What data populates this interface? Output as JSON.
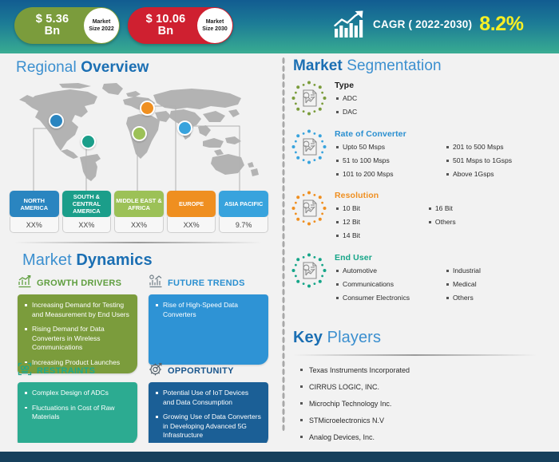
{
  "header": {
    "market_size_2022": {
      "amount": "$ 5.36",
      "unit": "Bn",
      "badge_line1": "Market",
      "badge_line2": "Size 2022",
      "color": "#7b9c3c"
    },
    "market_size_2030": {
      "amount": "$ 10.06",
      "unit": "Bn",
      "badge_line1": "Market",
      "badge_line2": "Size 2030",
      "color": "#cf2030"
    },
    "cagr_label": "CAGR ( 2022-2030)",
    "cagr_value": "8.2%",
    "cagr_color": "#f7ef25"
  },
  "regional": {
    "title_part1": "Regional ",
    "title_part2": "Overview",
    "regions": [
      {
        "name": "NORTH AMERICA",
        "value": "XX%",
        "color": "#2a85c0"
      },
      {
        "name": "SOUTH & CENTRAL AMERICA",
        "value": "XX%",
        "color": "#1b9e8a"
      },
      {
        "name": "MIDDLE EAST & AFRICA",
        "value": "XX%",
        "color": "#9cc157"
      },
      {
        "name": "EUROPE",
        "value": "XX%",
        "color": "#ef8f20"
      },
      {
        "name": "ASIA PACIFIC",
        "value": "9.7%",
        "color": "#38a3dd"
      }
    ]
  },
  "dynamics": {
    "title_part1": "Market ",
    "title_part2": "Dynamics",
    "growth_drivers": {
      "heading": "GROWTH DRIVERS",
      "icon": "bar-chart-growth-icon",
      "color": "#7b9c3c",
      "items": [
        "Increasing Demand for Testing and Measurement by End Users",
        "Rising Demand for Data Converters in Wireless Communications",
        "Increasing Product Launches"
      ]
    },
    "future_trends": {
      "heading": "FUTURE TRENDS",
      "icon": "trend-chart-icon",
      "color": "#2e93d5",
      "items": [
        "Rise of High-Speed Data Converters"
      ]
    },
    "restraints": {
      "heading": "RESTRAINTS",
      "icon": "constraint-brackets-icon",
      "color": "#2cab91",
      "items": [
        "Complex Design of ADCs",
        "Fluctuations in Cost of Raw Materials"
      ]
    },
    "opportunity": {
      "heading": "OPPORTUNITY",
      "icon": "gear-target-icon",
      "color": "#1b5f96",
      "items": [
        "Potential Use of IoT Devices and Data Consumption",
        "Growing Use of Data Converters in Developing Advanced 5G Infrastructure"
      ]
    }
  },
  "segmentation": {
    "title_part1": "Market ",
    "title_part2": "Segmentation",
    "groups": [
      {
        "label": "Type",
        "icon": "report-chart-document-icon",
        "dot_color": "#7b9c3c",
        "label_color": "#1f1f1f",
        "items": [
          "ADC",
          "DAC"
        ]
      },
      {
        "label": "Rate of Converter",
        "icon": "report-chart-document-icon",
        "dot_color": "#38a3dd",
        "label_color": "#2a8fd0",
        "items": [
          "Upto 50 Msps",
          "201 to 500 Msps",
          "51 to 100 Msps",
          "501 Msps to 1Gsps",
          "101 to 200 Msps",
          "Above 1Gsps"
        ]
      },
      {
        "label": "Resolution",
        "icon": "report-chart-document-icon",
        "dot_color": "#ef8f20",
        "label_color": "#ef8f20",
        "items": [
          "10 Bit",
          "16 Bit",
          "12 Bit",
          "Others",
          "14 Bit"
        ]
      },
      {
        "label": "End User",
        "icon": "report-chart-document-icon",
        "dot_color": "#15a588",
        "label_color": "#15a588",
        "items": [
          "Automotive",
          "Industrial",
          "Communications",
          "Medical",
          "Consumer Electronics",
          "Others"
        ]
      }
    ]
  },
  "key_players": {
    "title_part1": "Key ",
    "title_part2": "Players",
    "items": [
      "Texas Instruments Incorporated",
      "CIRRUS LOGIC, INC.",
      "Microchip Technology Inc.",
      "STMicroelectronics N.V",
      "Analog Devices, Inc."
    ]
  },
  "theme": {
    "header_gradient_start": "#125c91",
    "header_gradient_end": "#36a892",
    "page_background": "#f2f2f2",
    "footer_bar": "#17405c",
    "heading_blue": "#3b8fcf",
    "heading_blue_bold": "#1b6fb3"
  }
}
